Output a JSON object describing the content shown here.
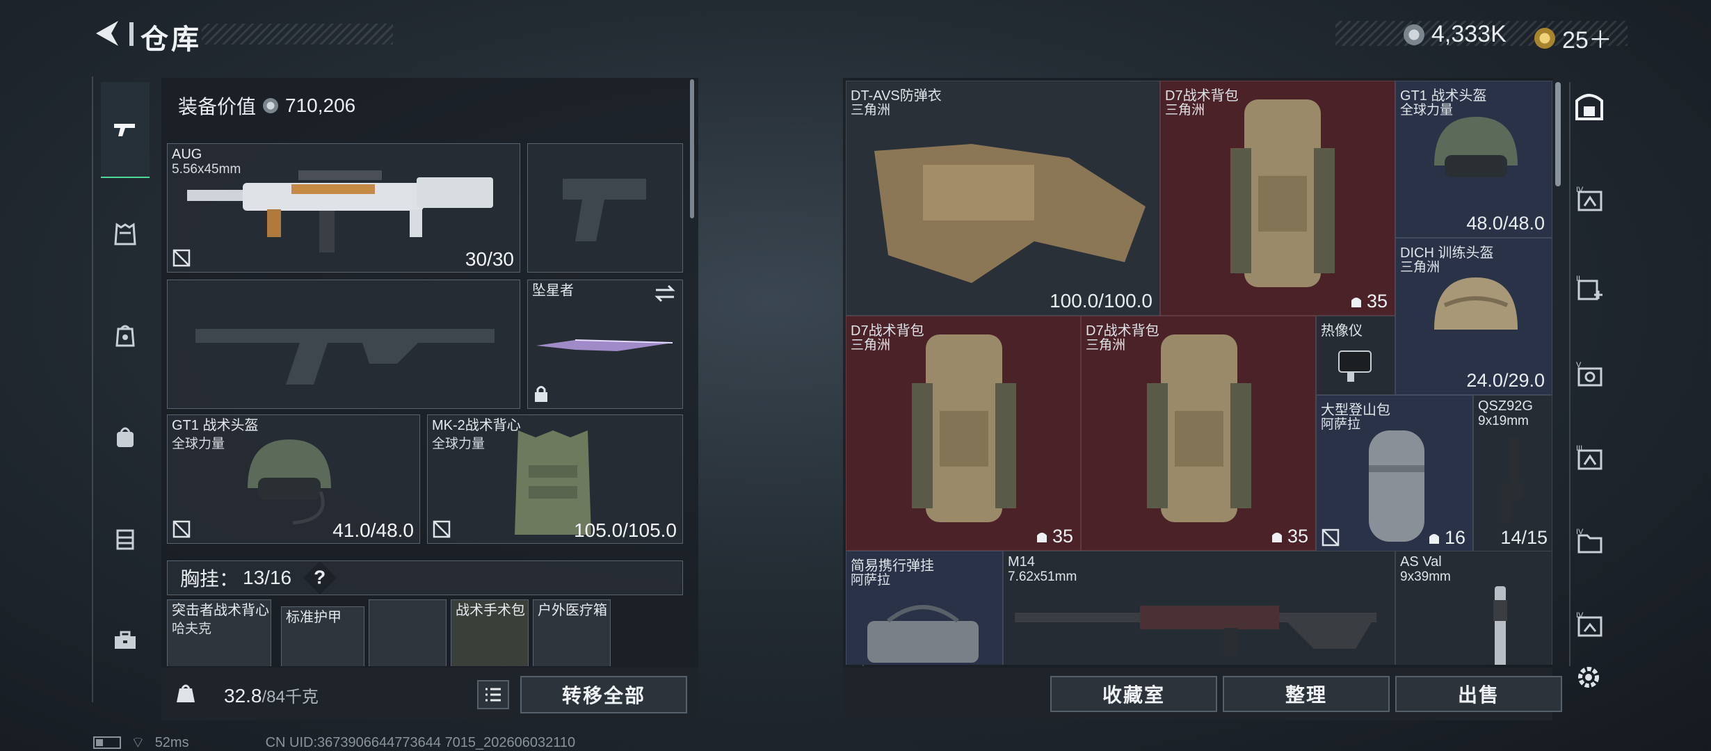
{
  "header": {
    "title": "仓库",
    "currency1": "4,333K",
    "currency2": "25＋"
  },
  "left_nav": {
    "items": [
      "weapon-icon",
      "armor-icon",
      "backpack-top-icon",
      "backpack-icon",
      "rig-icon",
      "toolbox-icon"
    ]
  },
  "loadout": {
    "equip_value_label": "装备价值",
    "equip_value": "710,206",
    "primary": {
      "name": "AUG",
      "caliber": "5.56x45mm",
      "ammo": "30/30"
    },
    "melee": {
      "name": "坠星者"
    },
    "helmet": {
      "name": "GT1 战术头盔",
      "sub": "全球力量",
      "durability": "41.0/48.0"
    },
    "vest": {
      "name": "MK-2战术背心",
      "sub": "全球力量",
      "durability": "105.0/105.0"
    },
    "chest_rig": {
      "label": "胸挂：",
      "capacity": "13/16",
      "help": "?"
    },
    "rig_items": [
      {
        "name": "突击者战术背心",
        "sub": "哈夫克"
      },
      {
        "name": "标准护甲"
      },
      {
        "name": ""
      },
      {
        "name": "战术手术包"
      },
      {
        "name": "户外医疗箱"
      }
    ],
    "weight": "32.8",
    "weight_max": "/84千克",
    "transfer_all": "转移全部"
  },
  "storage": {
    "items": [
      {
        "name": "DT-AVS防弹衣",
        "sub": "三角洲",
        "value": "100.0/100.0"
      },
      {
        "name": "D7战术背包",
        "sub": "三角洲",
        "value": "35"
      },
      {
        "name": "GT1 战术头盔",
        "sub": "全球力量",
        "value": "48.0/48.0"
      },
      {
        "name": "DICH 训练头盔",
        "sub": "三角洲",
        "value": "24.0/29.0"
      },
      {
        "name": "D7战术背包",
        "sub": "三角洲",
        "value": "35"
      },
      {
        "name": "D7战术背包",
        "sub": "三角洲",
        "value": "35"
      },
      {
        "name": "热像仪",
        "sub": "",
        "value": ""
      },
      {
        "name": "大型登山包",
        "sub": "阿萨拉",
        "value": "16"
      },
      {
        "name": "QSZ92G",
        "sub": "9x19mm",
        "value": "14/15"
      },
      {
        "name": "简易携行弹挂",
        "sub": "阿萨拉",
        "value": ""
      },
      {
        "name": "M14",
        "sub": "7.62x51mm",
        "value": ""
      },
      {
        "name": "AS Val",
        "sub": "9x39mm",
        "value": ""
      }
    ],
    "buttons": {
      "collection": "收藏室",
      "organize": "整理",
      "sell": "出售"
    }
  },
  "right_nav": {
    "items": [
      "safe-box-icon",
      "tier-iv-case-icon",
      "tier-ii-medical-icon",
      "tier-v-case-icon",
      "tier-iii-case-icon",
      "tier-iv-folder-icon",
      "tier-iv-case-icon-2",
      "settings-icon"
    ]
  },
  "status": {
    "ping": "52ms",
    "uid": "CN UID:3673906644773644 7015_202606032110"
  }
}
